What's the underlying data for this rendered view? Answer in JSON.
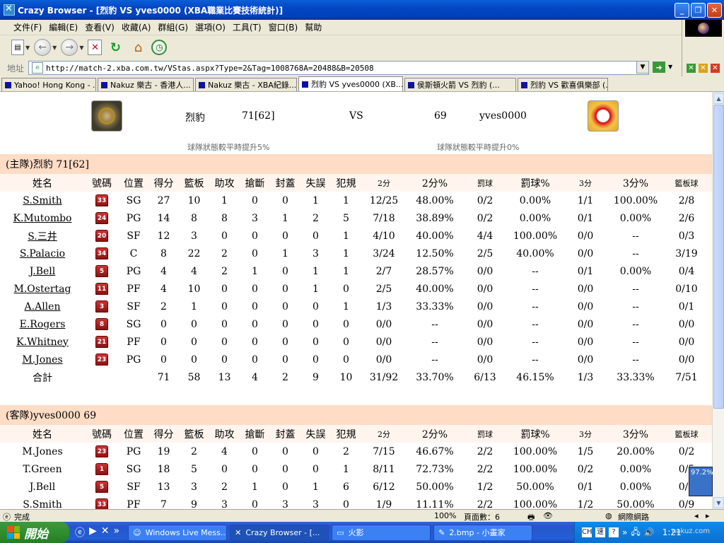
{
  "window": {
    "title": "Crazy Browser - [烈豹 VS yves0000 (XBA職業比賽技術統計)]"
  },
  "menu": [
    "文件(F)",
    "編輯(E)",
    "查看(V)",
    "收藏(A)",
    "群組(G)",
    "選項(O)",
    "工具(T)",
    "窗口(B)",
    "幫助"
  ],
  "address": {
    "label": "地址",
    "url": "http://match-2.xba.com.tw/VStas.aspx?Type=2&Tag=1008768A=20488&B=20508"
  },
  "tabs": [
    "Yahoo! Hong Kong - ...",
    "Nakuz 樂古 - 香港人...",
    "Nakuz 樂古 - XBA紀錄...",
    "烈豹 VS yves0000 (XB...",
    "侯斯頓火箭 VS 烈豹 (...",
    "烈豹 VS 歡喜俱樂部 (..."
  ],
  "active_tab": 3,
  "match": {
    "home_name": "烈豹",
    "home_score": "71[62]",
    "vs": "VS",
    "away_score": "69",
    "away_name": "yves0000",
    "home_note": "球隊狀態較平時提升5%",
    "away_note": "球隊狀態較平時提升0%"
  },
  "columns": [
    "姓名",
    "號碼",
    "位置",
    "得分",
    "籃板",
    "助攻",
    "搶斷",
    "封蓋",
    "失誤",
    "犯規",
    "2分",
    "2分%",
    "罰球",
    "罰球%",
    "3分",
    "3分%",
    "籃板球"
  ],
  "home": {
    "title": "(主隊)烈豹 71[62]",
    "players": [
      {
        "name": "S.Smith",
        "num": "33",
        "pos": "SG",
        "pts": "27",
        "reb": "10",
        "ast": "1",
        "stl": "0",
        "blk": "0",
        "to": "1",
        "pf": "1",
        "two": "12/25",
        "twop": "48.00%",
        "ft": "0/2",
        "ftp": "0.00%",
        "three": "1/1",
        "threep": "100.00%",
        "rebs": "2/8"
      },
      {
        "name": "K.Mutombo",
        "num": "24",
        "pos": "PG",
        "pts": "14",
        "reb": "8",
        "ast": "8",
        "stl": "3",
        "blk": "1",
        "to": "2",
        "pf": "5",
        "two": "7/18",
        "twop": "38.89%",
        "ft": "0/2",
        "ftp": "0.00%",
        "three": "0/1",
        "threep": "0.00%",
        "rebs": "2/6"
      },
      {
        "name": "S.三井",
        "num": "20",
        "pos": "SF",
        "pts": "12",
        "reb": "3",
        "ast": "0",
        "stl": "0",
        "blk": "0",
        "to": "0",
        "pf": "1",
        "two": "4/10",
        "twop": "40.00%",
        "ft": "4/4",
        "ftp": "100.00%",
        "three": "0/0",
        "threep": "--",
        "rebs": "0/3"
      },
      {
        "name": "S.Palacio",
        "num": "34",
        "pos": "C",
        "pts": "8",
        "reb": "22",
        "ast": "2",
        "stl": "0",
        "blk": "1",
        "to": "3",
        "pf": "1",
        "two": "3/24",
        "twop": "12.50%",
        "ft": "2/5",
        "ftp": "40.00%",
        "three": "0/0",
        "threep": "--",
        "rebs": "3/19"
      },
      {
        "name": "J.Bell",
        "num": "5",
        "pos": "PG",
        "pts": "4",
        "reb": "4",
        "ast": "2",
        "stl": "1",
        "blk": "0",
        "to": "1",
        "pf": "1",
        "two": "2/7",
        "twop": "28.57%",
        "ft": "0/0",
        "ftp": "--",
        "three": "0/1",
        "threep": "0.00%",
        "rebs": "0/4"
      },
      {
        "name": "M.Ostertag",
        "num": "11",
        "pos": "PF",
        "pts": "4",
        "reb": "10",
        "ast": "0",
        "stl": "0",
        "blk": "0",
        "to": "1",
        "pf": "0",
        "two": "2/5",
        "twop": "40.00%",
        "ft": "0/0",
        "ftp": "--",
        "three": "0/0",
        "threep": "--",
        "rebs": "0/10"
      },
      {
        "name": "A.Allen",
        "num": "3",
        "pos": "SF",
        "pts": "2",
        "reb": "1",
        "ast": "0",
        "stl": "0",
        "blk": "0",
        "to": "0",
        "pf": "1",
        "two": "1/3",
        "twop": "33.33%",
        "ft": "0/0",
        "ftp": "--",
        "three": "0/0",
        "threep": "--",
        "rebs": "0/1"
      },
      {
        "name": "E.Rogers",
        "num": "8",
        "pos": "SG",
        "pts": "0",
        "reb": "0",
        "ast": "0",
        "stl": "0",
        "blk": "0",
        "to": "0",
        "pf": "0",
        "two": "0/0",
        "twop": "--",
        "ft": "0/0",
        "ftp": "--",
        "three": "0/0",
        "threep": "--",
        "rebs": "0/0"
      },
      {
        "name": "K.Whitney",
        "num": "21",
        "pos": "PF",
        "pts": "0",
        "reb": "0",
        "ast": "0",
        "stl": "0",
        "blk": "0",
        "to": "0",
        "pf": "0",
        "two": "0/0",
        "twop": "--",
        "ft": "0/0",
        "ftp": "--",
        "three": "0/0",
        "threep": "--",
        "rebs": "0/0"
      },
      {
        "name": "M.Jones",
        "num": "23",
        "pos": "PG",
        "pts": "0",
        "reb": "0",
        "ast": "0",
        "stl": "0",
        "blk": "0",
        "to": "0",
        "pf": "0",
        "two": "0/0",
        "twop": "--",
        "ft": "0/0",
        "ftp": "--",
        "three": "0/0",
        "threep": "--",
        "rebs": "0/0"
      }
    ],
    "total": {
      "name": "合計",
      "pts": "71",
      "reb": "58",
      "ast": "13",
      "stl": "4",
      "blk": "2",
      "to": "9",
      "pf": "10",
      "two": "31/92",
      "twop": "33.70%",
      "ft": "6/13",
      "ftp": "46.15%",
      "three": "1/3",
      "threep": "33.33%",
      "rebs": "7/51"
    }
  },
  "away": {
    "title": "(客隊)yves0000 69",
    "players": [
      {
        "name": "M.Jones",
        "num": "23",
        "pos": "PG",
        "pts": "19",
        "reb": "2",
        "ast": "4",
        "stl": "0",
        "blk": "0",
        "to": "0",
        "pf": "2",
        "two": "7/15",
        "twop": "46.67%",
        "ft": "2/2",
        "ftp": "100.00%",
        "three": "1/5",
        "threep": "20.00%",
        "rebs": "0/2"
      },
      {
        "name": "T.Green",
        "num": "1",
        "pos": "SG",
        "pts": "18",
        "reb": "5",
        "ast": "0",
        "stl": "0",
        "blk": "0",
        "to": "0",
        "pf": "1",
        "two": "8/11",
        "twop": "72.73%",
        "ft": "2/2",
        "ftp": "100.00%",
        "three": "0/2",
        "threep": "0.00%",
        "rebs": "0/5"
      },
      {
        "name": "J.Bell",
        "num": "5",
        "pos": "SF",
        "pts": "13",
        "reb": "3",
        "ast": "2",
        "stl": "1",
        "blk": "0",
        "to": "1",
        "pf": "6",
        "two": "6/12",
        "twop": "50.00%",
        "ft": "1/2",
        "ftp": "50.00%",
        "three": "0/1",
        "threep": "0.00%",
        "rebs": "0/3"
      },
      {
        "name": "S.Smith",
        "num": "33",
        "pos": "PF",
        "pts": "7",
        "reb": "9",
        "ast": "3",
        "stl": "0",
        "blk": "3",
        "to": "3",
        "pf": "0",
        "two": "1/9",
        "twop": "11.11%",
        "ft": "2/2",
        "ftp": "100.00%",
        "three": "1/2",
        "threep": "50.00%",
        "rebs": "0/9"
      }
    ]
  },
  "status": {
    "text": "完成",
    "zoom": "100%",
    "pages": "頁面數：6",
    "zone": "網際網路"
  },
  "zoom_badge": "97.2%",
  "taskbar": {
    "start": "開始",
    "tasks": [
      "Windows Live Mess...",
      "Crazy Browser - [...",
      "火影",
      "2.bmp - 小畫家"
    ],
    "clock": "1:21"
  },
  "watermark": "nakuz.com"
}
